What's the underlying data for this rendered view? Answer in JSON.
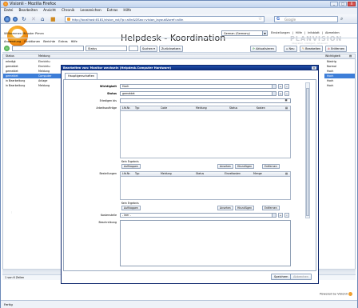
{
  "window": {
    "title": "Visionli - Mozilla Firefox",
    "controls": [
      "_",
      "□",
      "X"
    ]
  },
  "menubar": [
    "Datei",
    "Bearbeiten",
    "Ansicht",
    "Chronik",
    "Lesezeichen",
    "Extras",
    "Hilfe"
  ],
  "nav": {
    "url": "http://localhost:8181/vision_vst/?p=allin&DSav=vision_layout&lsref=allin",
    "search_placeholder": "Google"
  },
  "app": {
    "title": "Helpdesk - Koordination",
    "brand": "PLANVISION",
    "brand_sub": "Integrated - Intelligent - Advanced",
    "welcome": "Willkommen Minoder Pimen",
    "language": "German (Germany)",
    "links": [
      "Einstellungen",
      "Hilfe",
      "Infoblatt",
      "Abmelden"
    ]
  },
  "appmenu": [
    "Anwendung",
    "Funktionen",
    "Berichte",
    "Extras",
    "Hilfe"
  ],
  "toolbar": {
    "status_value": "Status",
    "search_label": "Suchen",
    "reset_label": "Zurücksetzen",
    "refresh_label": "Aktualisieren",
    "new_label": "Neu",
    "edit_label": "Bearbeiten",
    "delete_label": "Entfernen"
  },
  "grid": {
    "headers": {
      "status": "Status",
      "meldung": "Meldung",
      "wichtigkeit": "Wichtigkeit"
    },
    "left_rows": [
      {
        "status": "erledigt",
        "meldung": "Einrichtu"
      },
      {
        "status": "gemeldet",
        "meldung": "Einrichtu"
      },
      {
        "status": "gemeldet",
        "meldung": "Meldung"
      },
      {
        "status": "gemeldet",
        "meldung": "Computer"
      },
      {
        "status": "in Bearbeitung",
        "meldung": "Anlage"
      },
      {
        "status": "in Bearbeitung",
        "meldung": "Meldung"
      }
    ],
    "right_rows": [
      "Niedrig",
      "Normal",
      "Hoch",
      "Hoch",
      "Hoch",
      "Hoch"
    ],
    "count_text": "1 von 6 Zeilen"
  },
  "dialog": {
    "title": "Bearbeiten von: Monitor wechseln (Helpdesk.Computer Hardware)",
    "tab": "Hauptigenschaften",
    "fields": {
      "wichtigkeit_label": "Wichtigkeit",
      "wichtigkeit_value": "Hoch",
      "status_label": "Status",
      "status_value": "gemeldet",
      "erledigt_label": "Erledigen bis",
      "arbeitsauftraege_label": "Arbeitsaufträge",
      "bestellungen_label": "Bestellungen",
      "kostenstelle_label": "Kostenstelle",
      "kostenstelle_value": "- leer -",
      "beschreibung_label": "Beschreibung"
    },
    "auftraege_headers": [
      "Lfd.Nr.",
      "Typ",
      "Code",
      "Meldung",
      "Status",
      "Kosten"
    ],
    "bestell_headers": [
      "Lfd.Nr.",
      "Typ",
      "Meldung",
      "Status",
      "Einzelkosten",
      "Menge"
    ],
    "no_results": "Kein Ergebnis",
    "btn_aufklappen": "Aufklappen",
    "btn_ansehen": "Ansehen",
    "btn_hinzufuegen": "Hinzufügen",
    "btn_entfernen": "Entfernen",
    "save_label": "Speichern",
    "cancel_label": "Abbrechen"
  },
  "footer": {
    "powered": "Powered by Visionli"
  },
  "statusbar": "Fertig"
}
